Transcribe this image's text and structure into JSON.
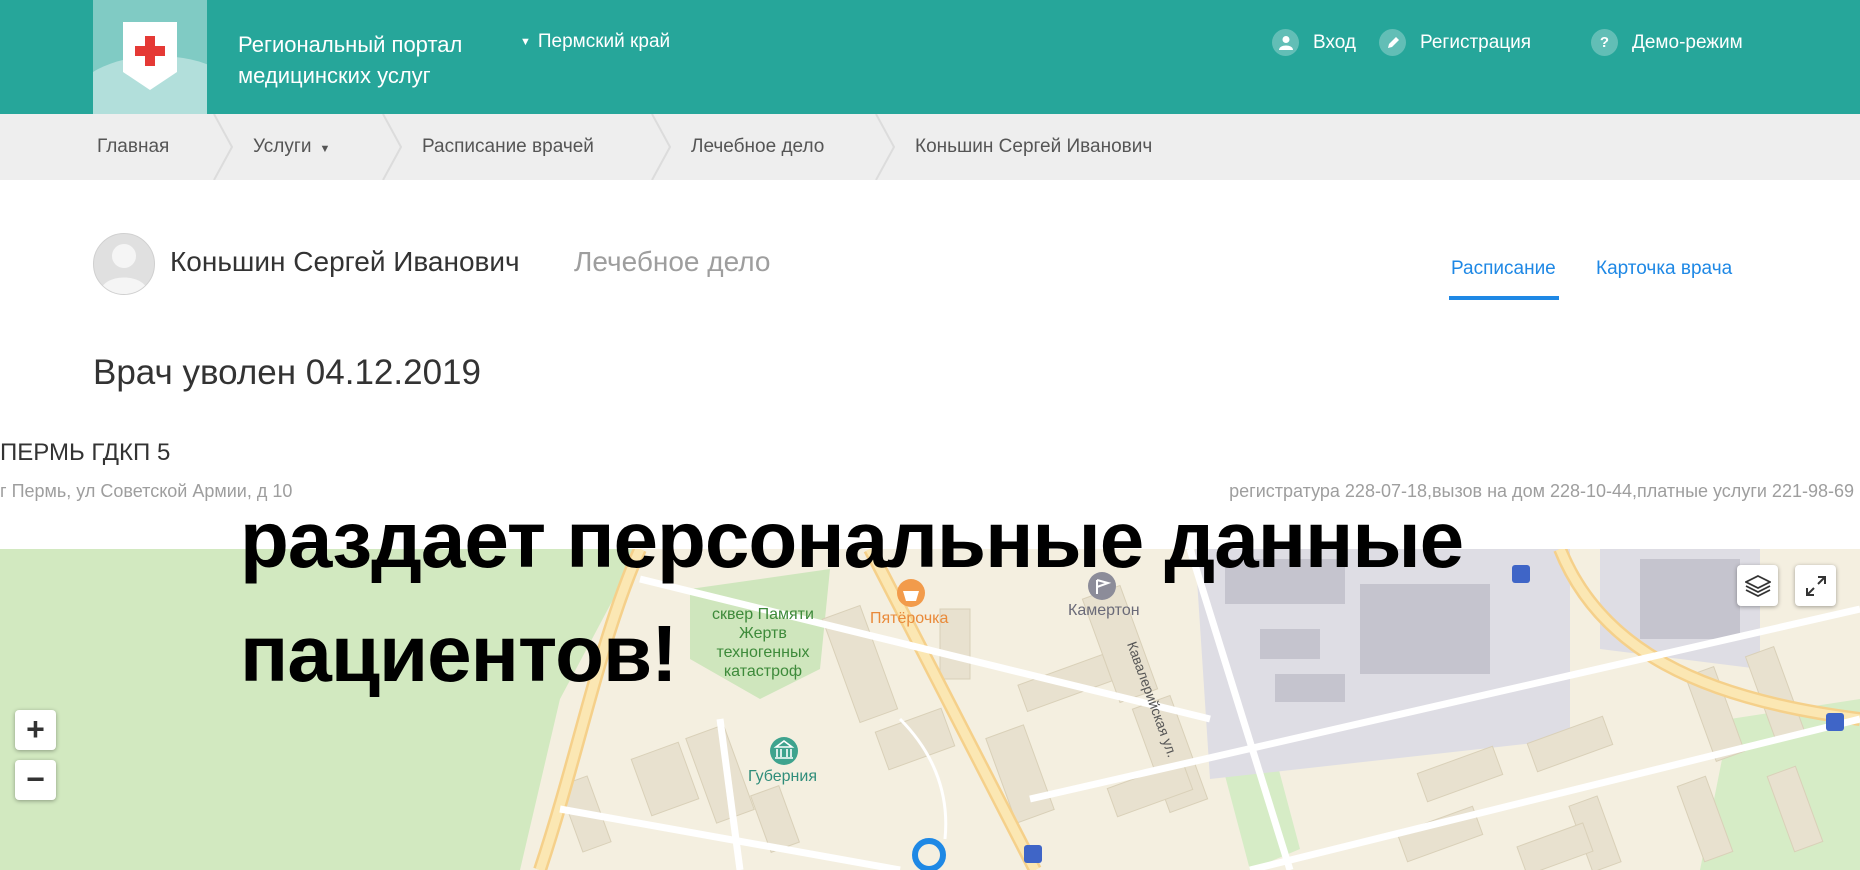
{
  "header": {
    "portal_title_line1": "Региональный портал",
    "portal_title_line2": "медицинских услуг",
    "region": "Пермский край",
    "login": "Вход",
    "register": "Регистрация",
    "demo": "Демо-режим"
  },
  "breadcrumb": [
    "Главная",
    "Услуги",
    "Расписание врачей",
    "Лечебное дело",
    "Коньшин Сергей Иванович"
  ],
  "doctor": {
    "name": "Коньшин Сергей Иванович",
    "specialty": "Лечебное дело",
    "status": "Врач уволен 04.12.2019"
  },
  "tabs": {
    "schedule": "Расписание",
    "card": "Карточка врача"
  },
  "clinic": {
    "name": "ПЕРМЬ ГДКП 5",
    "address": "г Пермь, ул Советской Армии, д 10",
    "phones": "регистратура 228-07-18,вызов на дом 228-10-44,платные услуги 221-98-69"
  },
  "map": {
    "labels": {
      "square": [
        "сквер Памяти",
        "Жертв",
        "техногенных",
        "катастроф"
      ],
      "shop": "Пятёрочка",
      "kamerton": "Камертон",
      "gubernia": "Губерния",
      "street": "Кавалерийская ул."
    },
    "zoom_in": "+",
    "zoom_out": "−"
  },
  "overlay": {
    "line1": "раздает персональные данные",
    "line2": "пациентов!"
  },
  "colors": {
    "header": "#26a69a",
    "accent": "#1e88e5",
    "park": "#d2e9c0"
  }
}
